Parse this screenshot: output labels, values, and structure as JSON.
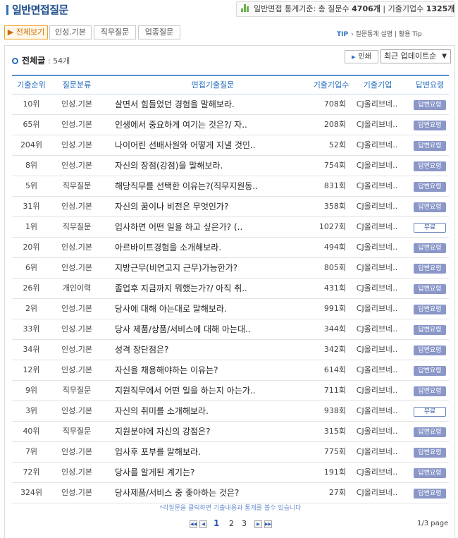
{
  "header": {
    "title": "일반면접질문",
    "stats_prefix": "일반면접 통계기준: 총 질문수 ",
    "total_questions": "4706개",
    "stats_sep": " | 기출기업수 ",
    "total_companies": "1325개",
    "stats_icon": "bar-chart-icon"
  },
  "tabs": [
    {
      "label": "▶ 전체보기",
      "active": true
    },
    {
      "label": "인성.기본",
      "active": false
    },
    {
      "label": "직무질문",
      "active": false
    },
    {
      "label": "업종질문",
      "active": false
    }
  ],
  "tip": {
    "tag": "TIP",
    "text": "› 질문통계 설명 | 활용 Tip"
  },
  "list": {
    "count_label": "전체글",
    "count_value": ": 54개",
    "print_label": "인쇄",
    "sort_selected": "최근 업데이트순"
  },
  "columns": [
    "기출순위",
    "질문분류",
    "면접기출질문",
    "기출기업수",
    "기출기업",
    "답변요령"
  ],
  "rows": [
    {
      "rank": "10위",
      "category": "인성.기본",
      "question": "살면서 힘들었던 경험을 말해보라.",
      "count": "708회",
      "company": "CJ올리브네..",
      "answer": "답변요령",
      "type": "pay"
    },
    {
      "rank": "65위",
      "category": "인성.기본",
      "question": "인생에서 중요하게 여기는 것은?/ 자..",
      "count": "208회",
      "company": "CJ올리브네..",
      "answer": "답변요령",
      "type": "pay"
    },
    {
      "rank": "204위",
      "category": "인성.기본",
      "question": "나이어린 선배사원와 어떻게 지낼 것인..",
      "count": "52회",
      "company": "CJ올리브네..",
      "answer": "답변요령",
      "type": "pay"
    },
    {
      "rank": "8위",
      "category": "인성.기본",
      "question": "자신의 장점(강점)을 말해보라.",
      "count": "754회",
      "company": "CJ올리브네..",
      "answer": "답변요령",
      "type": "pay"
    },
    {
      "rank": "5위",
      "category": "직무질문",
      "question": "해당직무를 선택한 이유는?(직무지원동..",
      "count": "831회",
      "company": "CJ올리브네..",
      "answer": "답변요령",
      "type": "pay"
    },
    {
      "rank": "31위",
      "category": "인성.기본",
      "question": "자신의 꿈이나 비전은 무엇인가?",
      "count": "358회",
      "company": "CJ올리브네..",
      "answer": "답변요령",
      "type": "pay"
    },
    {
      "rank": "1위",
      "category": "직무질문",
      "question": "입사하면 어떤 일을 하고 싶은가? (..",
      "count": "1027회",
      "company": "CJ올리브네..",
      "answer": "무료",
      "type": "free"
    },
    {
      "rank": "20위",
      "category": "인성.기본",
      "question": "아르바이트경험을 소개해보라.",
      "count": "494회",
      "company": "CJ올리브네..",
      "answer": "답변요령",
      "type": "pay"
    },
    {
      "rank": "6위",
      "category": "인성.기본",
      "question": "지방근무(비연고지 근무)가능한가?",
      "count": "805회",
      "company": "CJ올리브네..",
      "answer": "답변요령",
      "type": "pay"
    },
    {
      "rank": "26위",
      "category": "개인이력",
      "question": "졸업후 지금까지 뭐했는가?/ 아직 취..",
      "count": "431회",
      "company": "CJ올리브네..",
      "answer": "답변요령",
      "type": "pay"
    },
    {
      "rank": "2위",
      "category": "인성.기본",
      "question": "당사에 대해 아는대로 말해보라.",
      "count": "991회",
      "company": "CJ올리브네..",
      "answer": "답변요령",
      "type": "pay"
    },
    {
      "rank": "33위",
      "category": "인성.기본",
      "question": "당사 제품/상품/서비스에 대해 아는대..",
      "count": "344회",
      "company": "CJ올리브네..",
      "answer": "답변요령",
      "type": "pay"
    },
    {
      "rank": "34위",
      "category": "인성.기본",
      "question": "성격 장단점은?",
      "count": "342회",
      "company": "CJ올리브네..",
      "answer": "답변요령",
      "type": "pay"
    },
    {
      "rank": "12위",
      "category": "인성.기본",
      "question": "자신을 채용해야하는 이유는?",
      "count": "614회",
      "company": "CJ올리브네..",
      "answer": "답변요령",
      "type": "pay"
    },
    {
      "rank": "9위",
      "category": "직무질문",
      "question": "지원직무에서 어떤 일을 하는지 아는가..",
      "count": "711회",
      "company": "CJ올리브네..",
      "answer": "답변요령",
      "type": "pay"
    },
    {
      "rank": "3위",
      "category": "인성.기본",
      "question": "자신의 취미를 소개해보라.",
      "count": "938회",
      "company": "CJ올리브네..",
      "answer": "무료",
      "type": "free"
    },
    {
      "rank": "40위",
      "category": "직무질문",
      "question": "지원분야에 자신의 강점은?",
      "count": "315회",
      "company": "CJ올리브네..",
      "answer": "답변요령",
      "type": "pay"
    },
    {
      "rank": "7위",
      "category": "인성.기본",
      "question": "입사후 포부를 말해보라.",
      "count": "775회",
      "company": "CJ올리브네..",
      "answer": "답변요령",
      "type": "pay"
    },
    {
      "rank": "72위",
      "category": "인성.기본",
      "question": "당사를 알게된 계기는?",
      "count": "191회",
      "company": "CJ올리브네..",
      "answer": "답변요령",
      "type": "pay"
    },
    {
      "rank": "324위",
      "category": "인성.기본",
      "question": "당사제품/서비스 중 좋아하는 것은?",
      "count": "27회",
      "company": "CJ올리브네..",
      "answer": "답변요령",
      "type": "pay"
    }
  ],
  "note": "*각질문을 클릭하면 기출내용과 통계를 볼수 있습니다",
  "pagination": {
    "first": "◀◀",
    "prev": "◀",
    "next": "▶",
    "last": "▶▶",
    "pages": [
      "1",
      "2",
      "3"
    ],
    "current": "1",
    "page_info": "1/3 page"
  },
  "colors": {
    "accent": "#2a6fc0",
    "tab_active": "#f0a020",
    "pay_badge": "#8a97c8"
  }
}
